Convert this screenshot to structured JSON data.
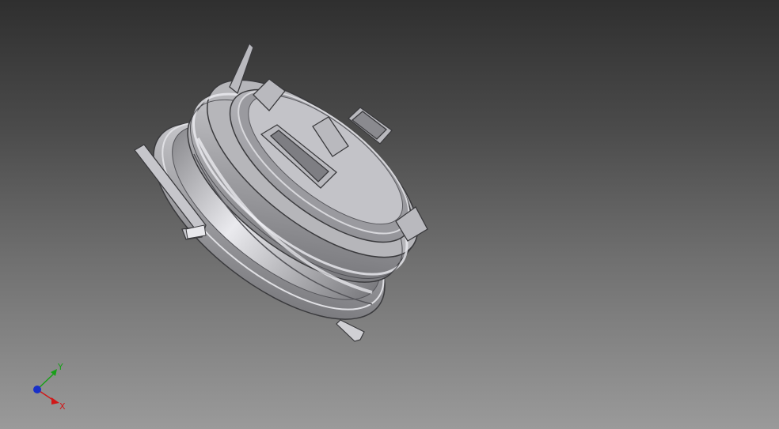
{
  "viewport": {
    "background_top": "#2f2f2f",
    "background_bottom": "#9a9a9a"
  },
  "model": {
    "icon": "cylindrical-connector-part",
    "body_color": "#a9a9ab",
    "shadow_color": "#6a6a6e",
    "highlight_color": "#e6e6ea",
    "edge_color": "#3a3a3d"
  },
  "triad": {
    "x_label": "X",
    "y_label": "Y",
    "x_color": "#d01818",
    "y_color": "#18a018",
    "z_color": "#1830c8"
  }
}
